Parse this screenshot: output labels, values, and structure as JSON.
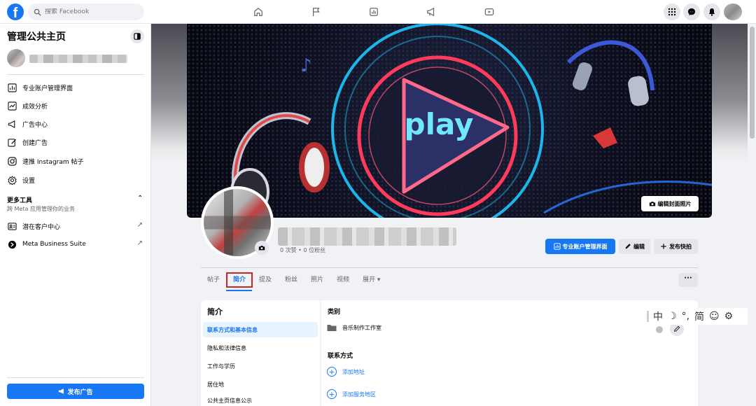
{
  "topbar": {
    "logo": "f",
    "search_placeholder": "搜索 Facebook",
    "nav_icons": [
      "home-icon",
      "flag-icon",
      "insights-icon",
      "megaphone-icon",
      "video-icon"
    ],
    "right_icons": [
      "grid-menu-icon",
      "messenger-icon",
      "bell-icon"
    ]
  },
  "sidebar": {
    "title": "管理公共主页",
    "items": [
      {
        "label": "专业账户管理界面",
        "icon": "dashboard-icon"
      },
      {
        "label": "成效分析",
        "icon": "insights-icon"
      },
      {
        "label": "广告中心",
        "icon": "megaphone-icon"
      },
      {
        "label": "创建广告",
        "icon": "pencil-icon"
      },
      {
        "label": "速推 Instagram 帖子",
        "icon": "instagram-icon"
      },
      {
        "label": "设置",
        "icon": "gear-icon"
      }
    ],
    "more_tools": {
      "title": "更多工具",
      "subtitle": "跨 Meta 应用管理你的业务",
      "items": [
        {
          "label": "潜在客户中心",
          "icon": "leads-icon"
        },
        {
          "label": "Meta Business Suite",
          "icon": "meta-suite-icon"
        }
      ]
    },
    "publish_button": "发布广告"
  },
  "cover": {
    "edit_label": "编辑封面照片",
    "artwork_text": "play"
  },
  "page": {
    "stats": "0 次赞 • 0 位粉丝",
    "buttons": {
      "dashboard": "专业账户管理界面",
      "edit": "编辑",
      "reel": "发布快拍"
    }
  },
  "tabs": [
    {
      "label": "帖子"
    },
    {
      "label": "简介"
    },
    {
      "label": "提及"
    },
    {
      "label": "粉丝"
    },
    {
      "label": "照片"
    },
    {
      "label": "视频"
    },
    {
      "label": "展开 ▾"
    }
  ],
  "more_button": "···",
  "about": {
    "title": "简介",
    "nav": [
      "联系方式和基本信息",
      "隐私和法律信息",
      "工作与学历",
      "居住地",
      "公共主页信息公示"
    ],
    "category_title": "类别",
    "category_value": "音乐制作工作室",
    "contact_title": "联系方式",
    "add_address": "添加地址",
    "add_service_area": "添加服务地区"
  },
  "ime": {
    "chars": [
      "中",
      "☽",
      "°,",
      "简",
      "☺",
      "⚙"
    ]
  },
  "colors": {
    "brand": "#1877f2",
    "highlight_box": "#c62828"
  }
}
